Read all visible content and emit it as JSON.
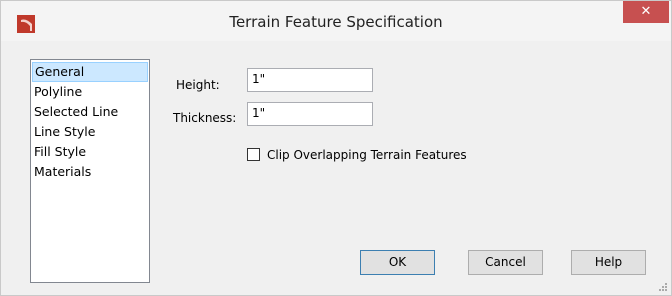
{
  "window": {
    "title": "Terrain Feature Specification",
    "close_label": "✕",
    "app_icon": "chief-architect-logo-icon"
  },
  "nav": {
    "items": [
      {
        "label": "General",
        "selected": true
      },
      {
        "label": "Polyline",
        "selected": false
      },
      {
        "label": "Selected Line",
        "selected": false
      },
      {
        "label": "Line Style",
        "selected": false
      },
      {
        "label": "Fill Style",
        "selected": false
      },
      {
        "label": "Materials",
        "selected": false
      }
    ]
  },
  "general": {
    "height_label": "Height:",
    "height_value": "1\"",
    "thickness_label": "Thickness:",
    "thickness_value": "1\"",
    "clip_label": "Clip Overlapping Terrain Features",
    "clip_checked": false
  },
  "buttons": {
    "ok": "OK",
    "cancel": "Cancel",
    "help": "Help"
  },
  "colors": {
    "close_bg": "#c75050",
    "selection_bg": "#cce8ff",
    "icon_red": "#c0392b"
  }
}
